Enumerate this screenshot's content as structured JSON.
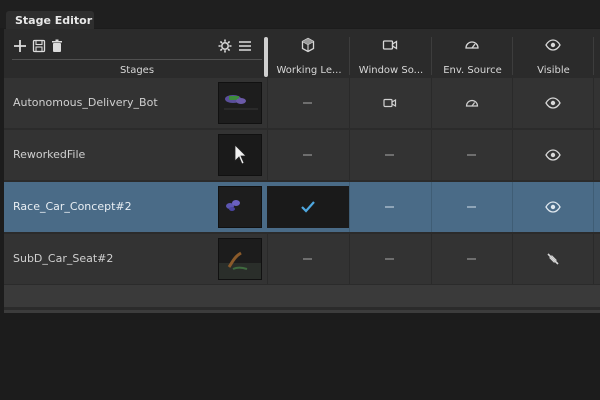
{
  "window": {
    "tab_title": "Stage Editor"
  },
  "toolbar": {
    "icons": [
      "add-icon",
      "save-icon",
      "delete-icon",
      "settings-icon",
      "menu-icon"
    ]
  },
  "columns": {
    "stages": "Stages",
    "working_level": "Working Le...",
    "window_source": "Window So...",
    "env_source": "Env. Source",
    "visible": "Visible"
  },
  "rows": [
    {
      "name": "Autonomous_Delivery_Bot",
      "working_level": false,
      "window_source": true,
      "env_source": true,
      "visible": "eye-icon",
      "selected": false
    },
    {
      "name": "ReworkedFile",
      "working_level": false,
      "window_source": false,
      "env_source": false,
      "visible": "eye-icon",
      "selected": false
    },
    {
      "name": "Race_Car_Concept#2",
      "working_level": true,
      "window_source": false,
      "env_source": false,
      "visible": "eye-icon",
      "selected": true
    },
    {
      "name": "SubD_Car_Seat#2",
      "working_level": false,
      "window_source": false,
      "env_source": false,
      "visible": "eye-slash-icon",
      "selected": false
    }
  ],
  "colors": {
    "selection": "#4a6b87",
    "check": "#4ea8e0",
    "panel": "#2b2b2b"
  }
}
